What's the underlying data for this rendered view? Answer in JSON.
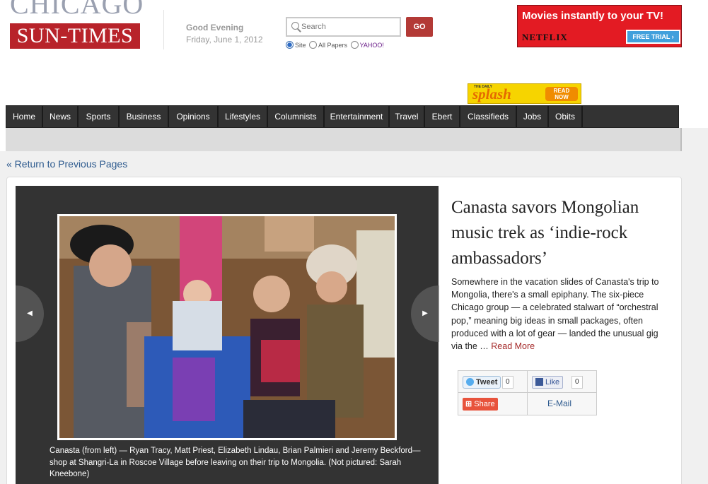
{
  "masthead": {
    "logo_top": "CHICAGO",
    "logo_bottom": "SUN-TIMES",
    "greeting": "Good Evening",
    "date": "Friday, June 1, 2012"
  },
  "search": {
    "placeholder": "Search",
    "go_label": "GO",
    "options": [
      {
        "label": "Site",
        "selected": true
      },
      {
        "label": "All Papers",
        "selected": false
      },
      {
        "label": "YAHOO!",
        "selected": false
      }
    ]
  },
  "netflix_ad": {
    "headline": "Movies instantly to your TV!",
    "brand": "NETFLIX",
    "cta": "FREE TRIAL"
  },
  "splash_ad": {
    "small": "THE DAILY",
    "word": "splash",
    "cta_line1": "READ",
    "cta_line2": "NOW"
  },
  "nav": {
    "items": [
      "Home",
      "News",
      "Sports",
      "Business",
      "Opinions",
      "Lifestyles",
      "Columnists",
      "Entertainment",
      "Travel",
      "Ebert",
      "Classifieds",
      "Jobs",
      "Obits"
    ]
  },
  "return_link": "« Return to Previous Pages",
  "article": {
    "headline": "Canasta savors Mongolian music trek as ‘indie-rock ambassadors’",
    "summary": "Somewhere in the vacation slides of Canasta's trip to Mongolia, there's a small epiphany. The six-piece Chicago group — a celebrated stalwart of “orchestral pop,” meaning big ideas in small packages, often produced with a lot of gear — landed the unusual gig via the … ",
    "read_more": "Read More",
    "caption": "Canasta (from left) — Ryan Tracy, Matt Priest, Elizabeth Lindau, Brian Palmieri and Jeremy Beckford— shop at Shangri-La in Roscoe Village before leaving on their trip to Mongolia. (Not pictured: Sarah Kneebone)"
  },
  "share": {
    "tweet_label": "Tweet",
    "tweet_count": "0",
    "like_label": "Like",
    "like_count": "0",
    "share_label": "Share",
    "email_label": "E-Mail"
  },
  "icons": {
    "prev": "prev-arrow-icon",
    "next": "next-arrow-icon",
    "search": "search-icon"
  },
  "colors": {
    "brand_red": "#b8232a",
    "nav_bg": "#333333",
    "link_blue": "#2d5a8e",
    "netflix_red": "#e31b23"
  }
}
